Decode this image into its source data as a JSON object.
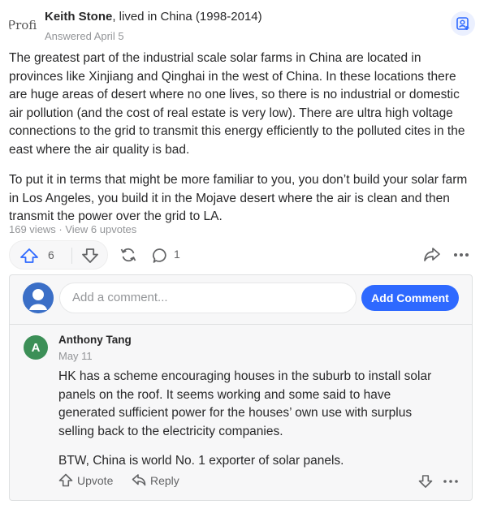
{
  "answer": {
    "avatar_alt": "Profi",
    "author_name": "Keith Stone",
    "author_credential": ", lived in China (1998-2014)",
    "answered_date": "Answered April 5",
    "paragraphs": [
      "The greatest part of the industrial scale solar farms in China are located in provinces like Xinjiang and Qinghai in the west of China. In these locations there are huge areas of desert where no one lives, so there is no industrial or domestic air pollution (and the cost of real estate is very low). There are ultra high voltage connections to the grid to transmit this energy efficiently to the polluted cites in the east where the air quality is bad.",
      "To put it in terms that might be more familiar to you, you don’t build your solar farm in Los Angeles, you build it in the Mojave desert where the air is clean and then transmit the power over the grid to LA."
    ],
    "meta": "169 views · View 6 upvotes"
  },
  "actions": {
    "upvote_count": "6",
    "comment_count": "1"
  },
  "composer": {
    "placeholder": "Add a comment...",
    "button_label": "Add Comment"
  },
  "comment": {
    "avatar_letter": "A",
    "author": "Anthony Tang",
    "date": "May 11",
    "paragraphs": [
      "HK has a scheme encouraging houses in the suburb to install solar panels on the roof. It seems working and some said to have generated sufficient power for the houses’ own use with surplus selling back to the electricity companies.",
      "BTW, China is world No. 1 exporter of solar panels."
    ],
    "upvote_label": "Upvote",
    "reply_label": "Reply"
  },
  "colors": {
    "accent": "#2e69ff",
    "text": "#282829",
    "muted": "#939598",
    "comment_avatar": "#3c8f57"
  }
}
